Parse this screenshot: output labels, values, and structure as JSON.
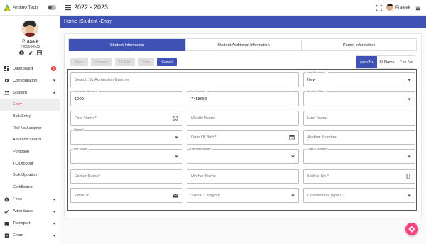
{
  "topbar": {
    "brand": "Amlino Tech",
    "year": "2022 - 2023",
    "user_name": "Prateek",
    "icons": [
      "logo-icon",
      "theme-toggle",
      "menu-icon",
      "fullscreen-icon",
      "list-icon"
    ]
  },
  "profile": {
    "name": "Prateek",
    "phone": "7985684535",
    "icons": [
      "account-icon",
      "edit-icon",
      "logout-icon"
    ]
  },
  "sidebar": {
    "items": [
      {
        "label": "Dashboard",
        "icon": "dashboard-icon",
        "badge": "5"
      },
      {
        "label": "Configuration",
        "icon": "settings-icon"
      },
      {
        "label": "Student",
        "icon": "people-icon",
        "expanded": true,
        "children": [
          "Entry",
          "Bulk Entry",
          "Roll No Assigner",
          "Advance Search",
          "Pomotion",
          "TC/Dropout",
          "Bulk Updation",
          "Certificates"
        ]
      },
      {
        "label": "Fees",
        "icon": "fees-icon"
      },
      {
        "label": "Attendance",
        "icon": "attendance-icon"
      },
      {
        "label": "Transport",
        "icon": "transport-icon"
      },
      {
        "label": "Exam",
        "icon": "exam-icon"
      }
    ],
    "active_child": "Entry"
  },
  "breadcrumb": "Home ›Student ›Entry",
  "tabs": [
    "Student Information",
    "Student Additional Information",
    "Parent Information"
  ],
  "actions": {
    "save": "Save",
    "preview": "Preview",
    "tc": "TC/Dipl.",
    "fees": "Fees",
    "cancel": "Cancel"
  },
  "search_mode": {
    "options": [
      "Adm No",
      "St Name",
      "Fee No"
    ],
    "selected": "Adm No"
  },
  "form": {
    "search_placeholder": "Search By Admission Number",
    "new_admission": {
      "label": "New Admission *",
      "value": "New"
    },
    "admission_number": {
      "label": "Admission Number*",
      "value": "1000"
    },
    "fee_number": {
      "label": "Fee Number*",
      "value": "7458659"
    },
    "admitted_class": {
      "label": "Admitted Class *",
      "value": ""
    },
    "first_name": "First Name*",
    "middle_name": "Middle Name",
    "last_name": "Last Name",
    "gender": {
      "label": "Gender*",
      "value": ""
    },
    "dob": "Date Of Birth*",
    "aadhar": "Aadhar Number",
    "fee_group": {
      "label": "Fee Group*",
      "value": ""
    },
    "fee_from_month": {
      "label": "Fee From Month*",
      "value": ""
    },
    "class_section": {
      "label": "Class & Section*",
      "value": ""
    },
    "father_name": "Father Name*",
    "mother_name": "Mother Name",
    "mobile": "Mobile No.*",
    "email": "Email Id",
    "social_category": "Social Category",
    "concession": "Concession Type ID"
  },
  "colors": {
    "primary": "#3f51b5",
    "active_nav": "#e53935",
    "fab": "#ff4081"
  }
}
